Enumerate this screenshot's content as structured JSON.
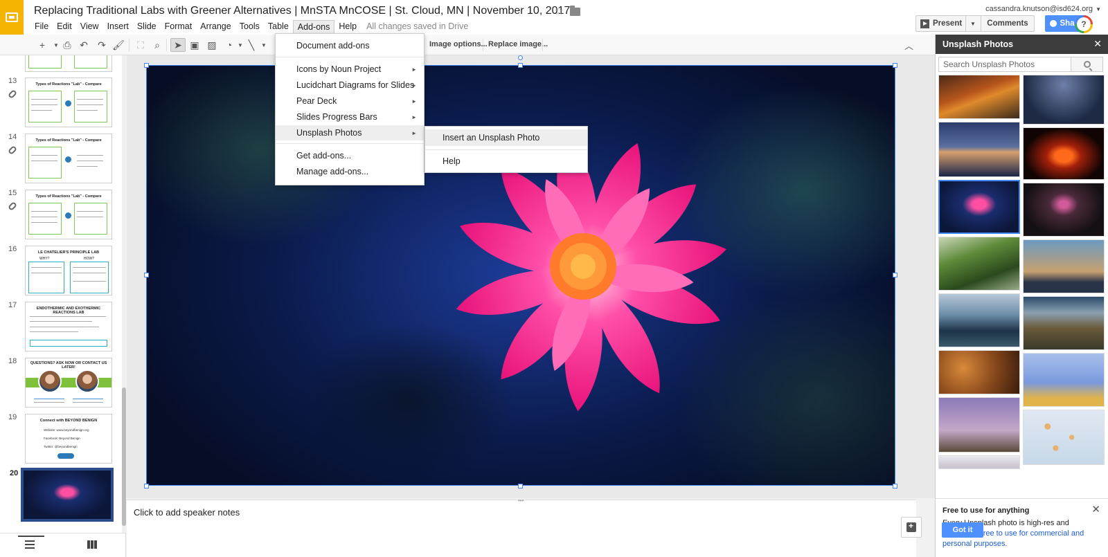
{
  "header": {
    "title": "Replacing Traditional Labs with Greener Alternatives | MnSTA MnCOSE | St. Cloud, MN | November 10, 2017",
    "menus": [
      "File",
      "Edit",
      "View",
      "Insert",
      "Slide",
      "Format",
      "Arrange",
      "Tools",
      "Table",
      "Add-ons",
      "Help"
    ],
    "active_menu": "Add-ons",
    "save_status": "All changes saved in Drive",
    "user_email": "cassandra.knutson@isd624.org",
    "present_label": "Present",
    "comments_label": "Comments",
    "share_label": "Share",
    "help_symbol": "?"
  },
  "toolbar": {
    "image_options_label": "Image options...",
    "replace_image_label": "Replace image...",
    "partial_label": "g"
  },
  "filmstrip": {
    "slides": [
      {
        "number": "13",
        "title": "Types of Reactions \"Lab\" - Compare"
      },
      {
        "number": "14",
        "title": "Types of Reactions \"Lab\" - Compare"
      },
      {
        "number": "15",
        "title": "Types of Reactions \"Lab\" - Compare"
      },
      {
        "number": "16",
        "title": "LE CHATELIER'S PRINCIPLE LAB"
      },
      {
        "number": "17",
        "title": "ENDOTHERMIC AND EXOTHERMIC REACTIONS LAB"
      },
      {
        "number": "18",
        "title": "QUESTIONS? ASK NOW OR CONTACT US LATER!"
      },
      {
        "number": "19",
        "title": "Connect with BEYOND BENIGN"
      },
      {
        "number": "20",
        "title": ""
      }
    ],
    "slide16_labels": [
      "WHY?",
      "HOW?"
    ],
    "slide19_lines": [
      "Website: www.beyondbenign.org",
      "Facebook: Beyond Benign",
      "Twitter: @beyondbenign"
    ]
  },
  "notes": {
    "placeholder": "Click to add speaker notes"
  },
  "addons_menu": {
    "items": [
      {
        "label": "Document add-ons",
        "has_submenu": false
      },
      {
        "label": "Icons by Noun Project",
        "has_submenu": true
      },
      {
        "label": "Lucidchart Diagrams for Slides",
        "has_submenu": true
      },
      {
        "label": "Pear Deck",
        "has_submenu": true
      },
      {
        "label": "Slides Progress Bars",
        "has_submenu": true
      },
      {
        "label": "Unsplash Photos",
        "has_submenu": true
      },
      {
        "label": "Get add-ons...",
        "has_submenu": false
      },
      {
        "label": "Manage add-ons...",
        "has_submenu": false
      }
    ],
    "submenu_items": [
      "Insert an Unsplash Photo",
      "Help"
    ]
  },
  "sidebar": {
    "title": "Unsplash Photos",
    "search_placeholder": "Search Unsplash Photos",
    "free_card": {
      "title": "Free to use for anything",
      "text_before": "Every Unsplash photo is high-res and completely ",
      "link_text": "free to use for commercial and personal purposes.",
      "button_label": "Got it"
    }
  }
}
